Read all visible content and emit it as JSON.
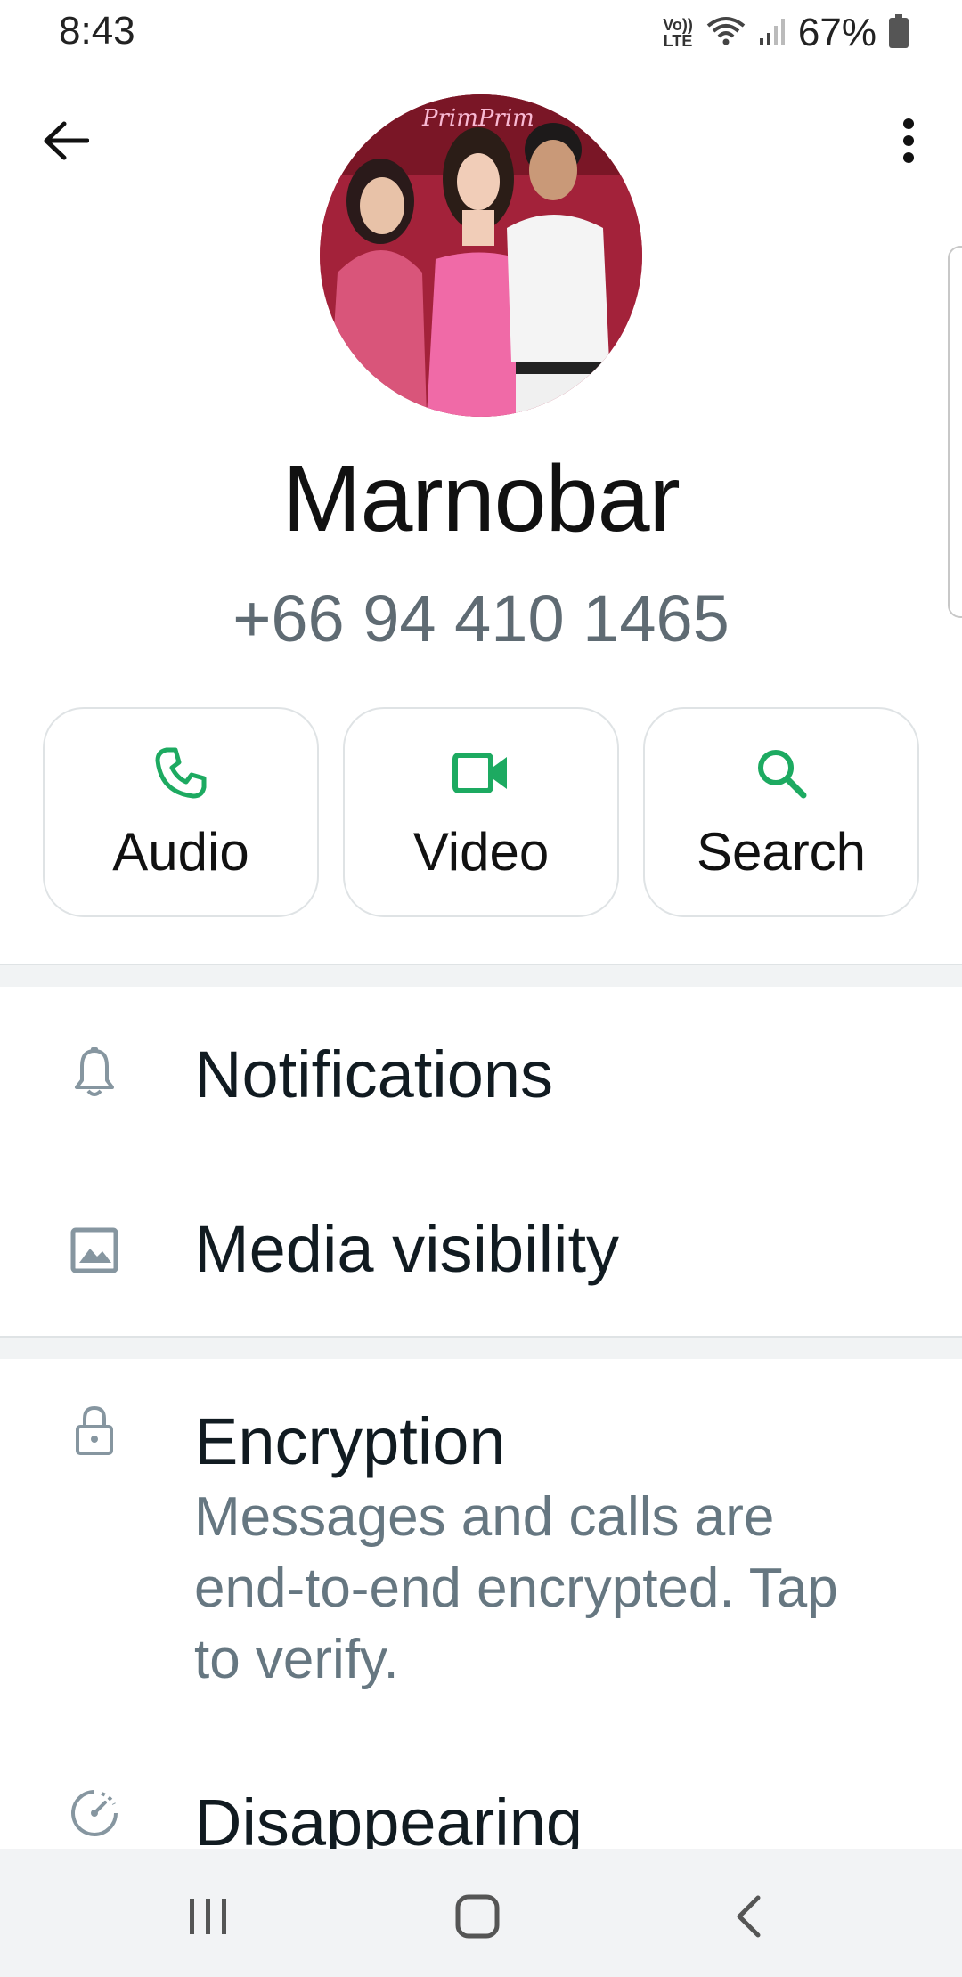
{
  "status_bar": {
    "time": "8:43",
    "volte_top": "Vo))",
    "volte_bottom": "LTE",
    "battery_percent": "67%"
  },
  "toolbar": {
    "back_icon": "arrow-left-icon",
    "more_icon": "more-vertical-icon"
  },
  "contact": {
    "name": "Marnobar",
    "phone": "+66 94 410 1465",
    "avatar_sign_text": "PrimPrim"
  },
  "actions": [
    {
      "label": "Audio",
      "icon": "phone-icon"
    },
    {
      "label": "Video",
      "icon": "video-camera-icon"
    },
    {
      "label": "Search",
      "icon": "search-icon"
    }
  ],
  "settings": {
    "notifications": {
      "title": "Notifications",
      "icon": "bell-icon"
    },
    "media_visibility": {
      "title": "Media visibility",
      "icon": "image-icon"
    },
    "encryption": {
      "title": "Encryption",
      "subtitle": "Messages and calls are end-to-end encrypted. Tap to verify.",
      "icon": "lock-icon"
    },
    "disappearing": {
      "title": "Disappearing",
      "icon": "timer-icon"
    }
  },
  "nav": {
    "recents_icon": "recents-icon",
    "home_icon": "home-icon",
    "back_icon": "nav-back-icon"
  },
  "colors": {
    "accent_green": "#1daa61",
    "secondary_text": "#667781",
    "divider": "#dfe3e5"
  }
}
